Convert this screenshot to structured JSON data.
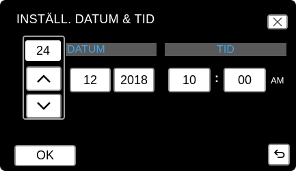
{
  "header": {
    "title": "INSTÄLL. DATUM & TID",
    "close_icon": "close-x-icon"
  },
  "day_stepper": {
    "value": "24",
    "up_icon": "chevron-up-icon",
    "down_icon": "chevron-down-icon"
  },
  "section_labels": {
    "date": "DATUM",
    "time": "TID"
  },
  "date": {
    "month": "12",
    "year": "2018"
  },
  "time": {
    "hour": "10",
    "separator": ":",
    "minute": "00",
    "period": "AM"
  },
  "footer": {
    "ok_label": "OK",
    "back_icon": "return-arrow-icon"
  },
  "colors": {
    "background": "#000000",
    "header_bar": "#595959",
    "header_text": "#3fa4e6",
    "button": "#ffffff"
  }
}
